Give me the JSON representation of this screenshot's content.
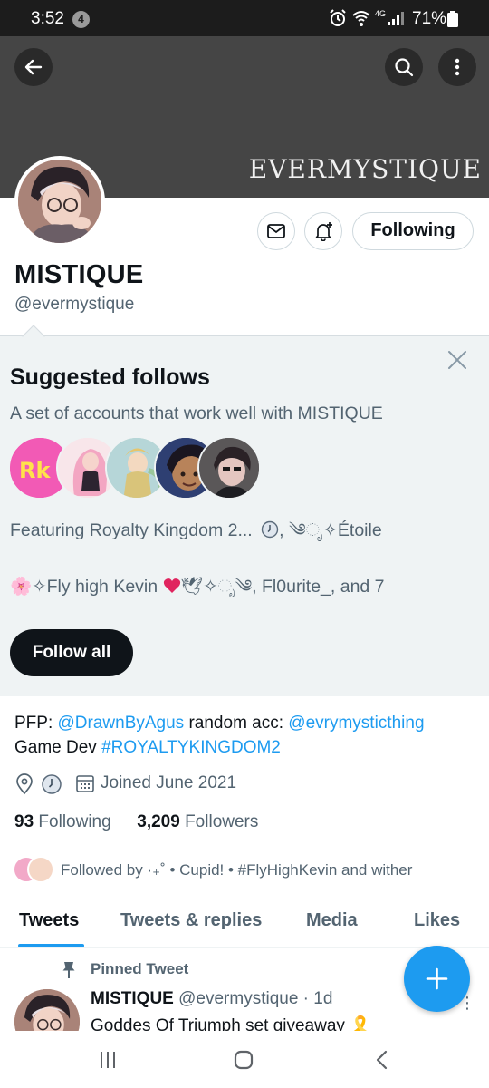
{
  "status_bar": {
    "time": "3:52",
    "notification_count": "4",
    "network": "4G",
    "battery": "71%"
  },
  "banner": {
    "text": "EVERMYSTIQUE"
  },
  "profile": {
    "display_name": "MISTIQUE",
    "handle": "@evermystique",
    "following_button": "Following"
  },
  "suggested": {
    "title": "Suggested follows",
    "subtitle": "A set of accounts that work well with MISTIQUE",
    "line1_prefix": "Featuring Royalty Kingdom 2...",
    "line1_suffix": ", ༄ೃ✧Étoile",
    "line2_prefix": "🌸✧Fly high Kevin",
    "line2_suffix": "🕊✧ೃ༄, Fl0urite_, and 7",
    "follow_all": "Follow all"
  },
  "bio": {
    "pfp_label": "PFP:",
    "pfp_link": "@DrawnByAgus",
    "random_label": "random acc:",
    "random_link": "@evrymysticthing",
    "line2_text": "Game Dev",
    "line2_hashtag": "#ROYALTYKINGDOM2",
    "joined": "Joined June 2021"
  },
  "counts": {
    "following_count": "93",
    "following_label": "Following",
    "followers_count": "3,209",
    "followers_label": "Followers"
  },
  "followed_by": "Followed by ·₊˚ • Cupid! • #FlyHighKevin and wither",
  "tabs": [
    "Tweets",
    "Tweets & replies",
    "Media",
    "Likes"
  ],
  "tweet": {
    "pinned_label": "Pinned Tweet",
    "author": "MISTIQUE",
    "handle_time": "@evermystique · 1d",
    "text": "Goddes Of Triumph set giveaway 🎗️"
  },
  "icons": {
    "back": "arrow-left-icon",
    "search": "search-icon",
    "more": "more-vertical-icon",
    "message": "mail-icon",
    "notify": "bell-plus-icon",
    "close": "close-icon",
    "location": "location-icon",
    "calendar": "calendar-icon",
    "pin": "pin-icon",
    "compose": "plus-icon"
  },
  "colors": {
    "accent": "#1d9bf0",
    "text_primary": "#0f1419",
    "text_secondary": "#536471",
    "banner": "#454545",
    "suggest_bg": "#eff3f4"
  }
}
